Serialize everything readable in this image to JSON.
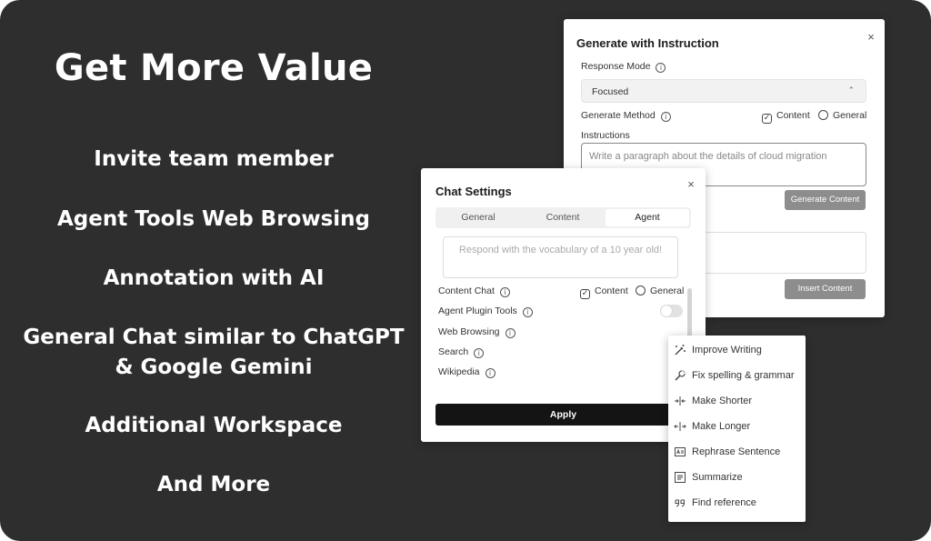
{
  "marketing": {
    "headline": "Get More Value",
    "features": [
      "Invite team member",
      "Agent Tools Web Browsing",
      "Annotation with AI",
      "General Chat similar to ChatGPT",
      "& Google Gemini",
      "Additional Workspace",
      "And More"
    ]
  },
  "generate_dialog": {
    "title": "Generate with Instruction",
    "close_glyph": "×",
    "response_mode_label": "Response Mode",
    "response_mode_value": "Focused",
    "generate_method_label": "Generate Method",
    "method_content": "Content",
    "method_general": "General",
    "instructions_label": "Instructions",
    "instructions_placeholder": "Write a paragraph about the details of cloud migration",
    "generate_button": "Generate Content",
    "insert_button": "Insert Content"
  },
  "chat_settings": {
    "title": "Chat Settings",
    "close_glyph": "×",
    "tabs": [
      "General",
      "Content",
      "Agent"
    ],
    "active_tab": "Agent",
    "prompt_placeholder": "Respond with the vocabulary of a 10 year old!",
    "content_chat_label": "Content Chat",
    "content_option": "Content",
    "general_option": "General",
    "agent_plugin_tools_label": "Agent Plugin Tools",
    "web_browsing_label": "Web Browsing",
    "search_label": "Search",
    "wikipedia_label": "Wikipedia",
    "apply_button": "Apply"
  },
  "ai_menu": {
    "items": [
      {
        "label": "Improve Writing",
        "icon": "magic-wand-icon"
      },
      {
        "label": "Fix spelling & grammar",
        "icon": "wrench-icon"
      },
      {
        "label": "Make Shorter",
        "icon": "shrink-icon"
      },
      {
        "label": "Make Longer",
        "icon": "expand-icon"
      },
      {
        "label": "Rephrase Sentence",
        "icon": "rephrase-icon"
      },
      {
        "label": "Summarize",
        "icon": "summary-icon"
      },
      {
        "label": "Find reference",
        "icon": "quote-icon"
      }
    ]
  }
}
